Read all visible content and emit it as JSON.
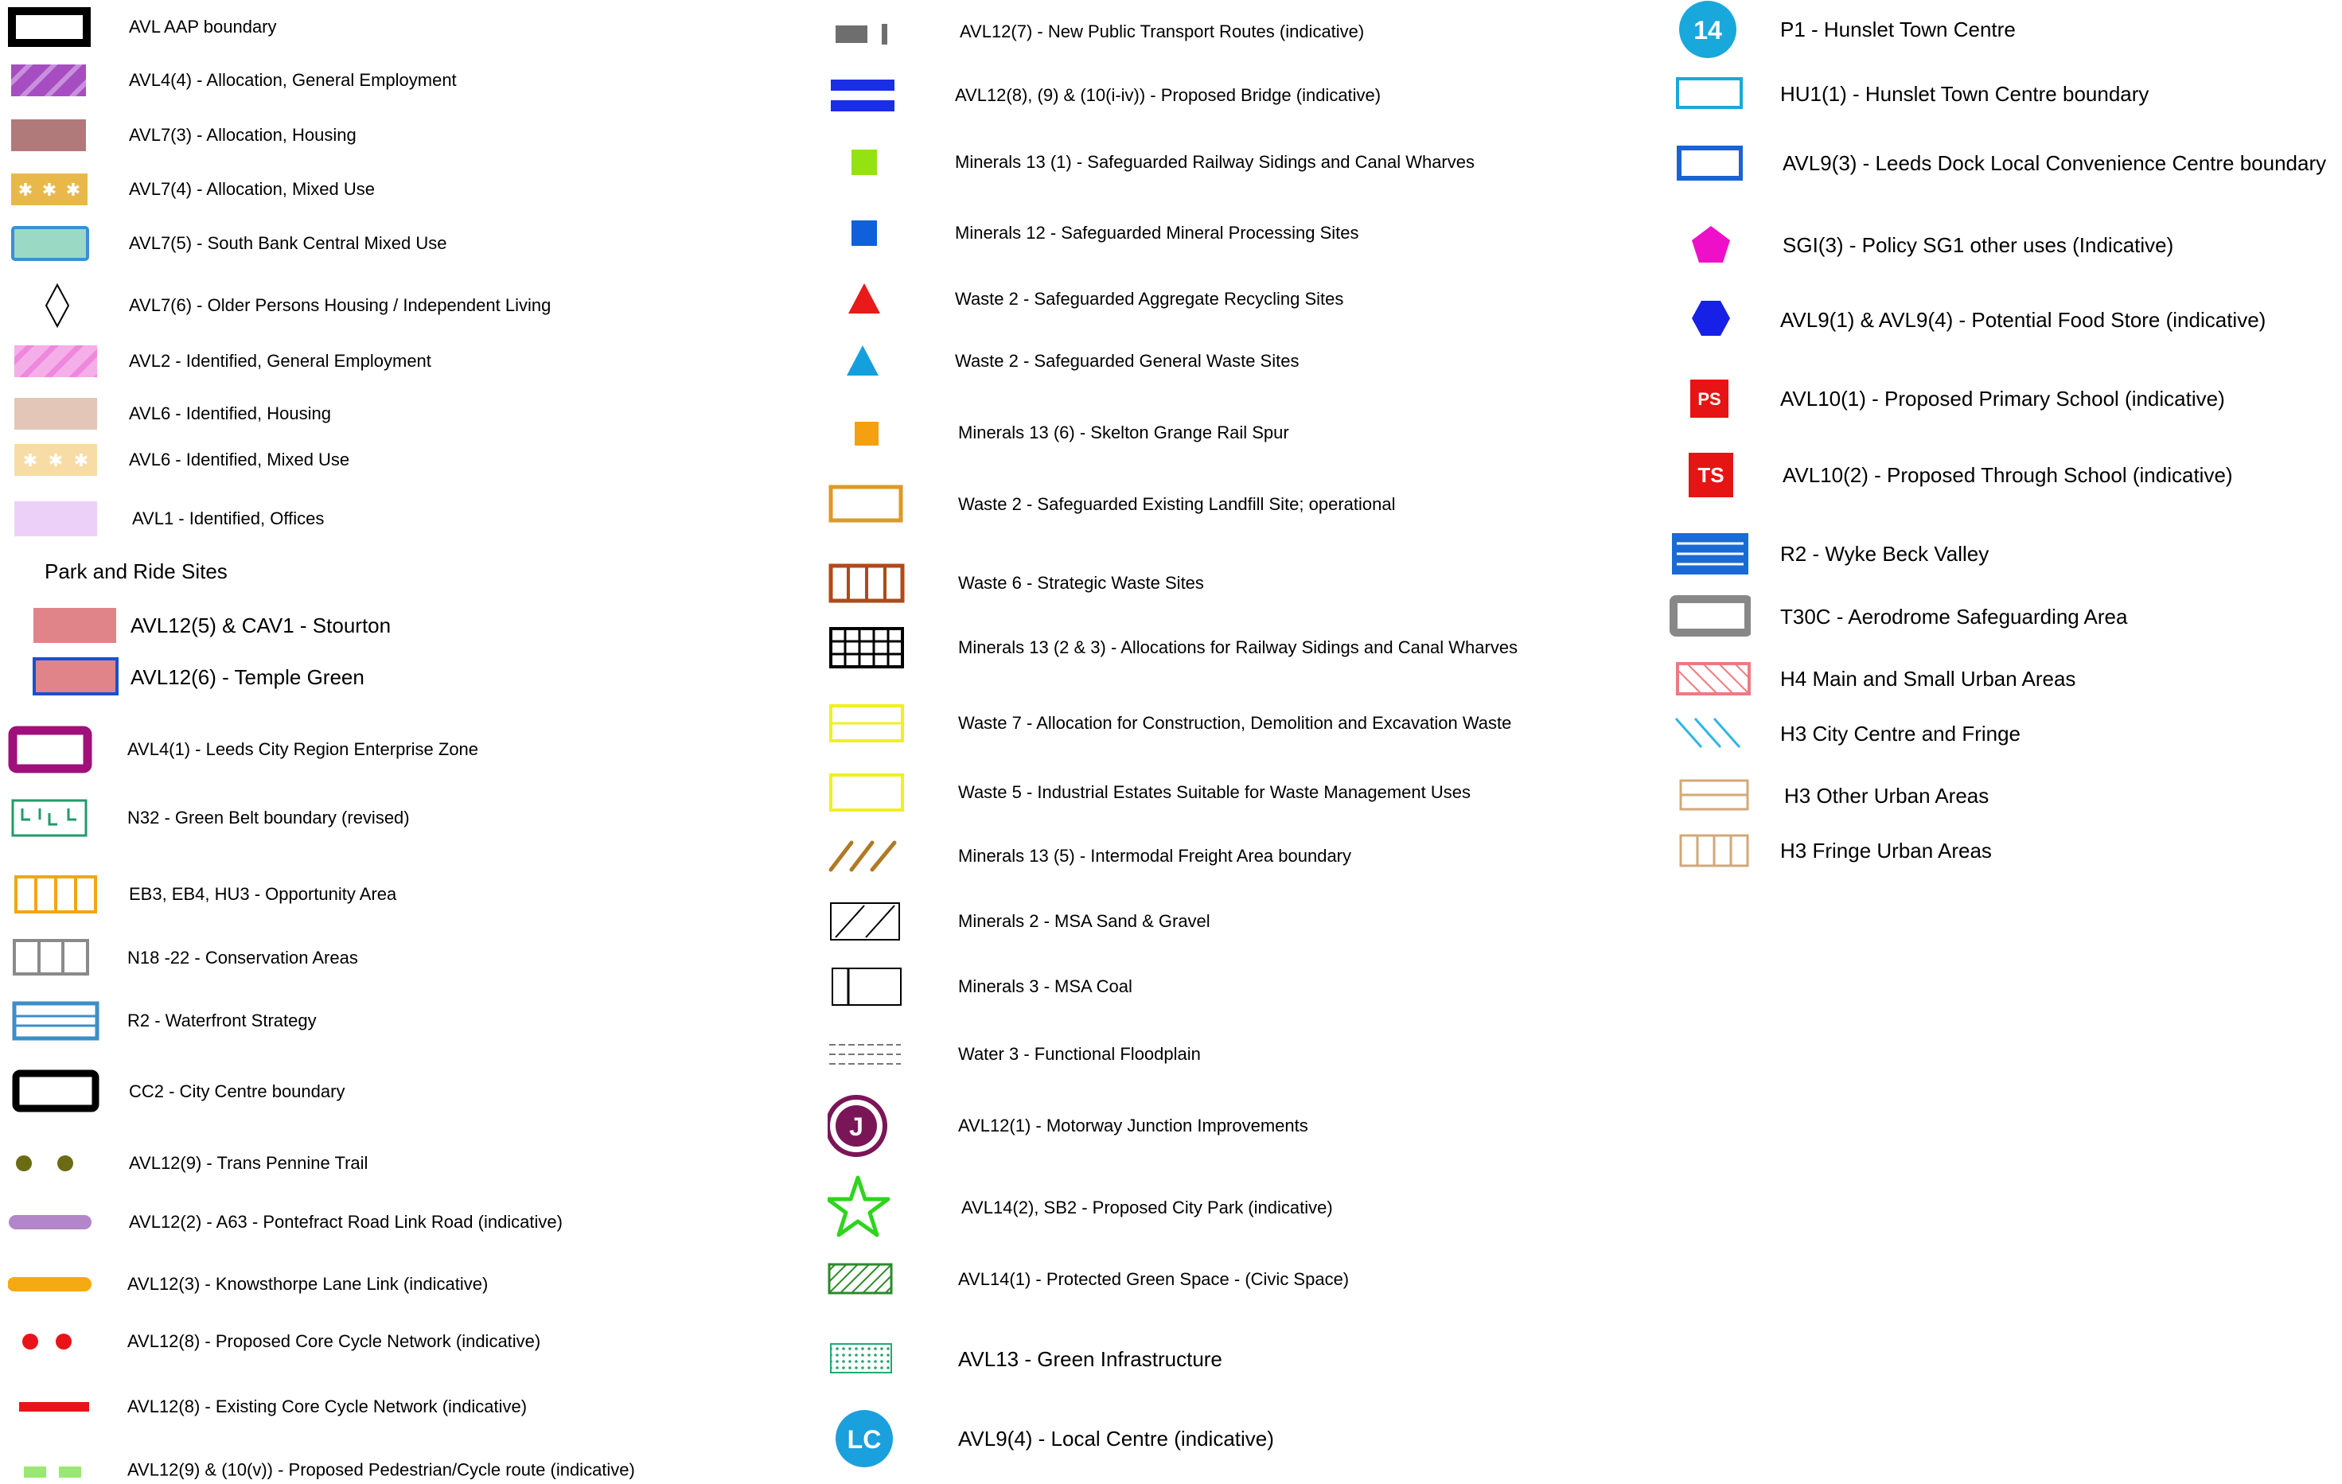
{
  "legend": {
    "column1": {
      "items": [
        {
          "label": "AVL AAP boundary"
        },
        {
          "label": "AVL4(4) - Allocation, General Employment"
        },
        {
          "label": "AVL7(3) - Allocation, Housing"
        },
        {
          "label": "AVL7(4) - Allocation, Mixed Use"
        },
        {
          "label": "AVL7(5) - South Bank Central Mixed Use"
        },
        {
          "label": "AVL7(6) - Older Persons Housing / Independent Living"
        },
        {
          "label": "AVL2 - Identified, General Employment"
        },
        {
          "label": "AVL6 - Identified, Housing"
        },
        {
          "label": "AVL6 - Identified, Mixed Use"
        },
        {
          "label": "AVL1 - Identified, Offices"
        }
      ],
      "park_and_ride": {
        "heading": "Park and Ride Sites",
        "items": [
          {
            "label": "AVL12(5) & CAV1 - Stourton"
          },
          {
            "label": "AVL12(6) - Temple Green"
          }
        ]
      },
      "items2": [
        {
          "label": "AVL4(1) - Leeds City Region Enterprise Zone"
        },
        {
          "label": "N32 - Green Belt boundary (revised)"
        },
        {
          "label": "EB3, EB4, HU3  - Opportunity Area"
        },
        {
          "label": "N18 -22 - Conservation Areas"
        },
        {
          "label": "R2 - Waterfront Strategy"
        },
        {
          "label": "CC2 - City Centre  boundary"
        },
        {
          "label": "AVL12(9) - Trans Pennine Trail"
        },
        {
          "label": "AVL12(2) - A63 - Pontefract Road Link Road (indicative)"
        },
        {
          "label": "AVL12(3) - Knowsthorpe Lane Link (indicative)"
        },
        {
          "label": "AVL12(8) - Proposed Core Cycle Network (indicative)"
        },
        {
          "label": "AVL12(8) - Existing Core Cycle Network (indicative)"
        },
        {
          "label": "AVL12(9) & (10(v)) - Proposed Pedestrian/Cycle route (indicative)"
        }
      ]
    },
    "column2": {
      "items": [
        {
          "label": "AVL12(7) - New Public Transport Routes (indicative)"
        },
        {
          "label": "AVL12(8), (9) & (10(i-iv)) - Proposed Bridge (indicative)"
        },
        {
          "label": "Minerals 13 (1)  - Safeguarded Railway Sidings and Canal Wharves"
        },
        {
          "label": "Minerals 12 - Safeguarded Mineral Processing Sites"
        },
        {
          "label": "Waste 2 - Safeguarded Aggregate Recycling Sites"
        },
        {
          "label": "Waste 2 - Safeguarded General Waste Sites"
        },
        {
          "label": "Minerals 13 (6) - Skelton Grange Rail Spur"
        },
        {
          "label": "Waste 2 - Safeguarded Existing Landfill Site; operational"
        },
        {
          "label": "Waste 6  -  Strategic Waste Sites"
        },
        {
          "label": "Minerals 13 (2 & 3) - Allocations for Railway Sidings and Canal Wharves"
        },
        {
          "label": "Waste 7 - Allocation for Construction, Demolition and Excavation Waste"
        },
        {
          "label": "Waste 5 - Industrial Estates Suitable for Waste Management Uses"
        },
        {
          "label": "Minerals 13 (5) - Intermodal Freight Area boundary"
        },
        {
          "label": "Minerals 2 - MSA Sand & Gravel"
        },
        {
          "label": "Minerals 3 - MSA Coal"
        },
        {
          "label": "Water 3 - Functional Floodplain"
        },
        {
          "label": "AVL12(1) - Motorway Junction Improvements",
          "badge": "J"
        },
        {
          "label": "AVL14(2), SB2 - Proposed City Park (indicative)"
        },
        {
          "label": "AVL14(1) - Protected Green Space - (Civic Space)"
        },
        {
          "label": "AVL13 - Green Infrastructure"
        },
        {
          "label": "AVL9(4) - Local Centre (indicative)",
          "badge": "LC"
        }
      ]
    },
    "column3": {
      "items": [
        {
          "label": "P1 - Hunslet Town Centre",
          "badge": "14"
        },
        {
          "label": "HU1(1) - Hunslet Town Centre boundary"
        },
        {
          "label": "AVL9(3) - Leeds Dock Local Convenience Centre boundary"
        },
        {
          "label": "SGI(3) - Policy SG1 other uses (Indicative)"
        },
        {
          "label": "AVL9(1) & AVL9(4) - Potential Food Store (indicative)"
        },
        {
          "label": "AVL10(1) - Proposed Primary School (indicative)",
          "badge": "PS"
        },
        {
          "label": "AVL10(2) - Proposed Through School (indicative)",
          "badge": "TS"
        },
        {
          "label": "R2 - Wyke Beck Valley"
        },
        {
          "label": "T30C  - Aerodrome Safeguarding Area"
        },
        {
          "label": "H4 Main and Small Urban Areas"
        },
        {
          "label": "H3 City Centre and Fringe"
        },
        {
          "label": "H3 Other Urban Areas"
        },
        {
          "label": "H3 Fringe Urban Areas"
        }
      ]
    }
  },
  "colors": {
    "employment_purple": "#a64dc2",
    "housing_brown": "#b17a7a",
    "mixed_use_gold": "#e8b94a",
    "south_bank_fill": "#9ad9c4",
    "south_bank_border": "#3a8fd6",
    "identified_employment_pink": "#ee88dd",
    "identified_housing": "#e3c6b8",
    "identified_mixed_use": "#f8dca6",
    "identified_offices": "#edd0f8",
    "park_ride_fill": "#e0848a",
    "enterprise_zone": "#a0107a",
    "green_belt": "#239a6a",
    "opportunity_orange": "#f3a515",
    "conservation_grey": "#8a8a8a",
    "waterfront_blue": "#3c8ec8",
    "trans_pennine_olive": "#6b6b14",
    "link_road_lilac": "#b286c8",
    "knowsthorpe_orange": "#f5aa12",
    "cycle_red": "#e8141a",
    "pedestrian_green": "#9ae873",
    "bridge_blue": "#1a2ee6",
    "rail_sidings_green": "#95e212",
    "mineral_processing_blue": "#1060dc",
    "aggregate_red": "#e81a1a",
    "general_waste_cyan": "#14a0dc",
    "rail_spur_orange": "#f5a010",
    "landfill_orange": "#dc9a28",
    "strategic_waste_brown": "#b04a18",
    "cde_waste_yellow": "#f0f020",
    "freight_brown": "#b07a24",
    "junction_maroon": "#7a1658",
    "city_park_green": "#2ed41e",
    "civic_green": "#2c8a2c",
    "green_infra": "#23a873",
    "local_centre_blue": "#1aa0dc",
    "hunslet_blue": "#18a8dc",
    "leeds_dock_blue": "#1a62d6",
    "sg1_magenta": "#ee10c8",
    "food_store_blue": "#1620e6",
    "school_red": "#e61414",
    "wyke_beck_blue": "#1a6ad6",
    "aerodrome_grey": "#888888",
    "urban_salmon": "#ee7a80",
    "city_centre_cyan": "#2eb6e6",
    "urban_tan": "#d2a878"
  }
}
